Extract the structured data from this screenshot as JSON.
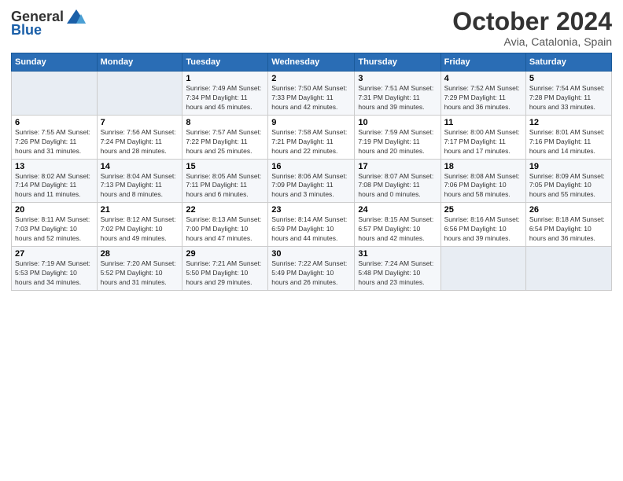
{
  "header": {
    "logo_general": "General",
    "logo_blue": "Blue",
    "month_title": "October 2024",
    "location": "Avia, Catalonia, Spain"
  },
  "days_of_week": [
    "Sunday",
    "Monday",
    "Tuesday",
    "Wednesday",
    "Thursday",
    "Friday",
    "Saturday"
  ],
  "weeks": [
    [
      {
        "day": "",
        "info": ""
      },
      {
        "day": "",
        "info": ""
      },
      {
        "day": "1",
        "info": "Sunrise: 7:49 AM\nSunset: 7:34 PM\nDaylight: 11 hours and 45 minutes."
      },
      {
        "day": "2",
        "info": "Sunrise: 7:50 AM\nSunset: 7:33 PM\nDaylight: 11 hours and 42 minutes."
      },
      {
        "day": "3",
        "info": "Sunrise: 7:51 AM\nSunset: 7:31 PM\nDaylight: 11 hours and 39 minutes."
      },
      {
        "day": "4",
        "info": "Sunrise: 7:52 AM\nSunset: 7:29 PM\nDaylight: 11 hours and 36 minutes."
      },
      {
        "day": "5",
        "info": "Sunrise: 7:54 AM\nSunset: 7:28 PM\nDaylight: 11 hours and 33 minutes."
      }
    ],
    [
      {
        "day": "6",
        "info": "Sunrise: 7:55 AM\nSunset: 7:26 PM\nDaylight: 11 hours and 31 minutes."
      },
      {
        "day": "7",
        "info": "Sunrise: 7:56 AM\nSunset: 7:24 PM\nDaylight: 11 hours and 28 minutes."
      },
      {
        "day": "8",
        "info": "Sunrise: 7:57 AM\nSunset: 7:22 PM\nDaylight: 11 hours and 25 minutes."
      },
      {
        "day": "9",
        "info": "Sunrise: 7:58 AM\nSunset: 7:21 PM\nDaylight: 11 hours and 22 minutes."
      },
      {
        "day": "10",
        "info": "Sunrise: 7:59 AM\nSunset: 7:19 PM\nDaylight: 11 hours and 20 minutes."
      },
      {
        "day": "11",
        "info": "Sunrise: 8:00 AM\nSunset: 7:17 PM\nDaylight: 11 hours and 17 minutes."
      },
      {
        "day": "12",
        "info": "Sunrise: 8:01 AM\nSunset: 7:16 PM\nDaylight: 11 hours and 14 minutes."
      }
    ],
    [
      {
        "day": "13",
        "info": "Sunrise: 8:02 AM\nSunset: 7:14 PM\nDaylight: 11 hours and 11 minutes."
      },
      {
        "day": "14",
        "info": "Sunrise: 8:04 AM\nSunset: 7:13 PM\nDaylight: 11 hours and 8 minutes."
      },
      {
        "day": "15",
        "info": "Sunrise: 8:05 AM\nSunset: 7:11 PM\nDaylight: 11 hours and 6 minutes."
      },
      {
        "day": "16",
        "info": "Sunrise: 8:06 AM\nSunset: 7:09 PM\nDaylight: 11 hours and 3 minutes."
      },
      {
        "day": "17",
        "info": "Sunrise: 8:07 AM\nSunset: 7:08 PM\nDaylight: 11 hours and 0 minutes."
      },
      {
        "day": "18",
        "info": "Sunrise: 8:08 AM\nSunset: 7:06 PM\nDaylight: 10 hours and 58 minutes."
      },
      {
        "day": "19",
        "info": "Sunrise: 8:09 AM\nSunset: 7:05 PM\nDaylight: 10 hours and 55 minutes."
      }
    ],
    [
      {
        "day": "20",
        "info": "Sunrise: 8:11 AM\nSunset: 7:03 PM\nDaylight: 10 hours and 52 minutes."
      },
      {
        "day": "21",
        "info": "Sunrise: 8:12 AM\nSunset: 7:02 PM\nDaylight: 10 hours and 49 minutes."
      },
      {
        "day": "22",
        "info": "Sunrise: 8:13 AM\nSunset: 7:00 PM\nDaylight: 10 hours and 47 minutes."
      },
      {
        "day": "23",
        "info": "Sunrise: 8:14 AM\nSunset: 6:59 PM\nDaylight: 10 hours and 44 minutes."
      },
      {
        "day": "24",
        "info": "Sunrise: 8:15 AM\nSunset: 6:57 PM\nDaylight: 10 hours and 42 minutes."
      },
      {
        "day": "25",
        "info": "Sunrise: 8:16 AM\nSunset: 6:56 PM\nDaylight: 10 hours and 39 minutes."
      },
      {
        "day": "26",
        "info": "Sunrise: 8:18 AM\nSunset: 6:54 PM\nDaylight: 10 hours and 36 minutes."
      }
    ],
    [
      {
        "day": "27",
        "info": "Sunrise: 7:19 AM\nSunset: 5:53 PM\nDaylight: 10 hours and 34 minutes."
      },
      {
        "day": "28",
        "info": "Sunrise: 7:20 AM\nSunset: 5:52 PM\nDaylight: 10 hours and 31 minutes."
      },
      {
        "day": "29",
        "info": "Sunrise: 7:21 AM\nSunset: 5:50 PM\nDaylight: 10 hours and 29 minutes."
      },
      {
        "day": "30",
        "info": "Sunrise: 7:22 AM\nSunset: 5:49 PM\nDaylight: 10 hours and 26 minutes."
      },
      {
        "day": "31",
        "info": "Sunrise: 7:24 AM\nSunset: 5:48 PM\nDaylight: 10 hours and 23 minutes."
      },
      {
        "day": "",
        "info": ""
      },
      {
        "day": "",
        "info": ""
      }
    ]
  ]
}
